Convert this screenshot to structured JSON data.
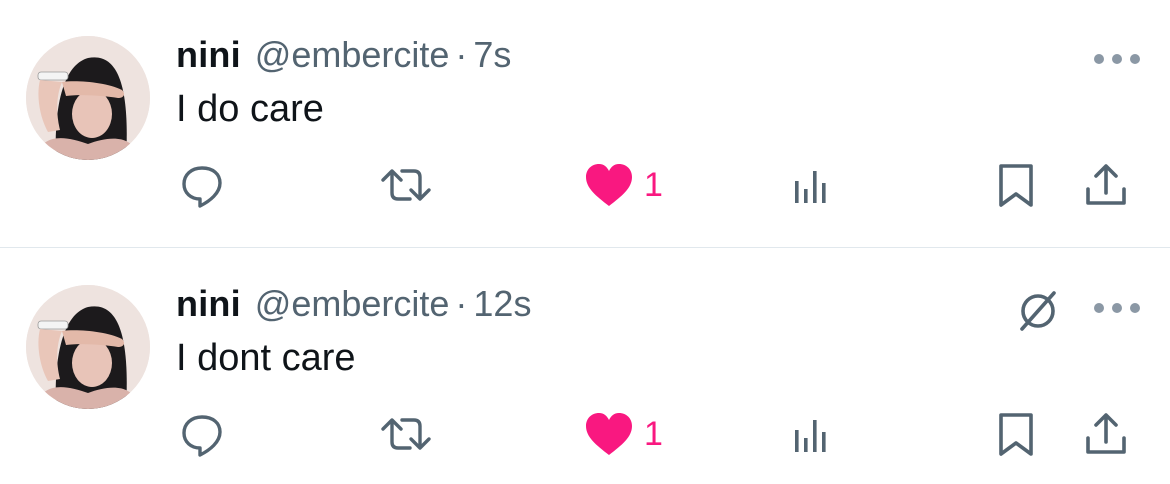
{
  "tweets": [
    {
      "author_name": "nini",
      "handle": "@embercite",
      "separator": "·",
      "time": "7s",
      "text": "I do care",
      "like_count": "1",
      "has_grok_icon": false
    },
    {
      "author_name": "nini",
      "handle": "@embercite",
      "separator": "·",
      "time": "12s",
      "text": "I dont care",
      "like_count": "1",
      "has_grok_icon": true
    }
  ],
  "icons": {
    "reply": "reply-icon",
    "retweet": "retweet-icon",
    "like": "heart-icon",
    "views": "views-icon",
    "bookmark": "bookmark-icon",
    "share": "share-icon",
    "more": "more-icon",
    "grok": "grok-icon"
  },
  "colors": {
    "text": "#0f1419",
    "secondary": "#536471",
    "like": "#f91880",
    "divider": "#e1e8ed"
  }
}
